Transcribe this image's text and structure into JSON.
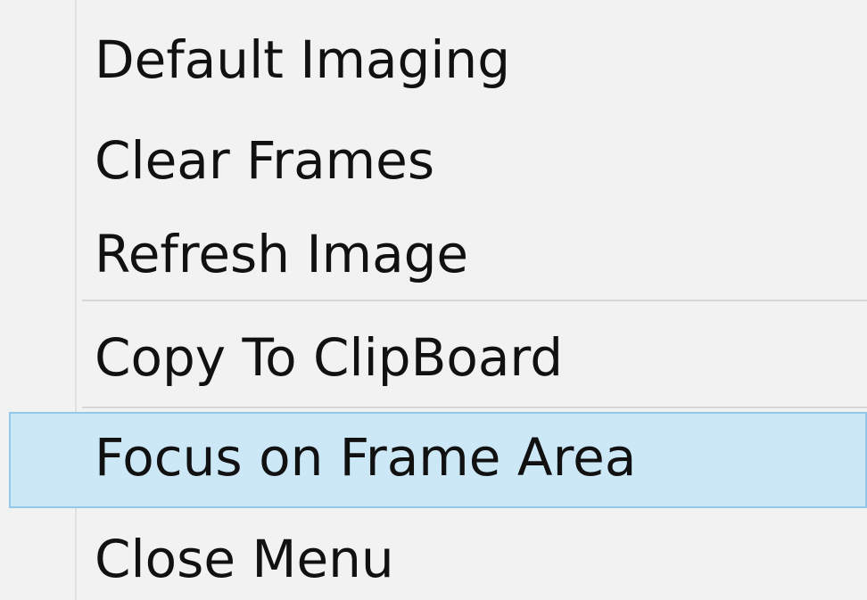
{
  "context_menu": {
    "items": [
      {
        "label": "Default Imaging",
        "highlighted": false
      },
      {
        "label": "Clear Frames",
        "highlighted": false
      },
      {
        "label": "Refresh Image",
        "highlighted": false
      },
      {
        "label": "Copy To ClipBoard",
        "highlighted": false
      },
      {
        "label": "Focus on Frame Area",
        "highlighted": true
      },
      {
        "label": "Close Menu",
        "highlighted": false
      }
    ],
    "colors": {
      "background": "#f2f2f2",
      "highlight_fill": "#cce8f7",
      "highlight_border": "#93c8ea",
      "text": "#111111",
      "separator": "#d7d7d7"
    }
  }
}
